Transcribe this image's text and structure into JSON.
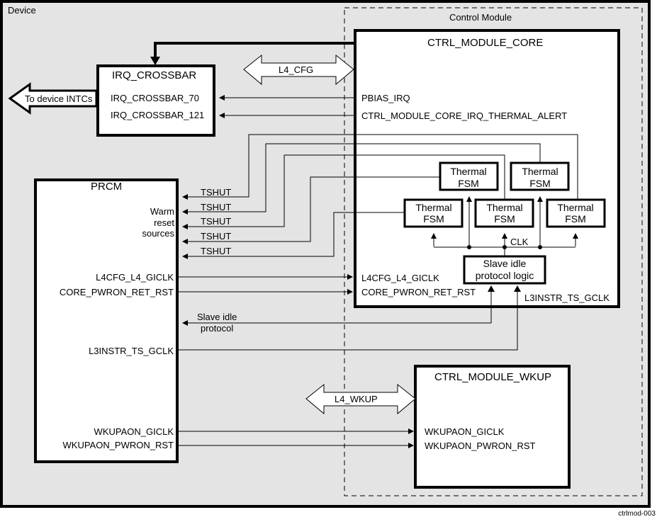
{
  "device": {
    "label": "Device"
  },
  "control_module": {
    "label": "Control Module"
  },
  "footer_id": "ctrlmod-003",
  "irq_crossbar": {
    "title": "IRQ_CROSSBAR",
    "ports": [
      "IRQ_CROSSBAR_70",
      "IRQ_CROSSBAR_121"
    ],
    "out_arrow": "To device INTCs"
  },
  "ctrl_module_core": {
    "title": "CTRL_MODULE_CORE",
    "outputs": [
      "PBIAS_IRQ",
      "CTRL_MODULE_CORE_IRQ_THERMAL_ALERT"
    ],
    "inputs": [
      "L4CFG_L4_GICLK",
      "CORE_PWRON_RET_RST"
    ],
    "clk_in": "L3INSTR_TS_GCLK",
    "thermal_fsm": [
      "Thermal",
      "FSM"
    ],
    "clk_label": "CLK",
    "slave_idle": [
      "Slave idle",
      "protocol logic"
    ]
  },
  "bus_l4_cfg": "L4_CFG",
  "bus_l4_wkup": "L4_WKUP",
  "prcm": {
    "title": "PRCM",
    "warm_reset": [
      "Warm",
      "reset",
      "sources"
    ],
    "tshut": [
      "TSHUT",
      "TSHUT",
      "TSHUT",
      "TSHUT",
      "TSHUT"
    ],
    "outputs": [
      "L4CFG_L4_GICLK",
      "CORE_PWRON_RET_RST",
      "L3INSTR_TS_GCLK",
      "WKUPAON_GICLK",
      "WKUPAON_PWRON_RST"
    ],
    "slave_idle": [
      "Slave idle",
      "protocol"
    ]
  },
  "ctrl_module_wkup": {
    "title": "CTRL_MODULE_WKUP",
    "inputs": [
      "WKUPAON_GICLK",
      "WKUPAON_PWRON_RST"
    ]
  },
  "colors": {
    "background": "#e4e4e4",
    "box": "#ffffff",
    "stroke": "#000000"
  }
}
